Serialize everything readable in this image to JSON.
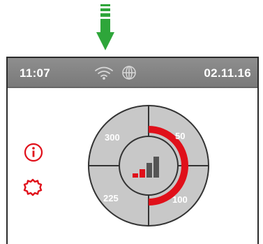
{
  "status": {
    "time": "11:07",
    "date": "02.11.16",
    "icons": [
      "wifi-icon",
      "globe-icon"
    ]
  },
  "side_menu": {
    "icons": [
      "info-icon",
      "gear-icon"
    ]
  },
  "dial": {
    "segments": [
      {
        "position": "top-left",
        "label": "300"
      },
      {
        "position": "top-right",
        "label": "50"
      },
      {
        "position": "bottom-left",
        "label": "225"
      },
      {
        "position": "bottom-right",
        "label": "100"
      }
    ],
    "center_icon": "signal-strength-icon",
    "active_range_start": "50",
    "active_range_end": "100"
  },
  "colors": {
    "accent": "#e0101a",
    "arrow": "#2ea63a",
    "statusbar": "#858585",
    "dial_fill": "#c8c8c8",
    "dial_stroke": "#333333"
  }
}
